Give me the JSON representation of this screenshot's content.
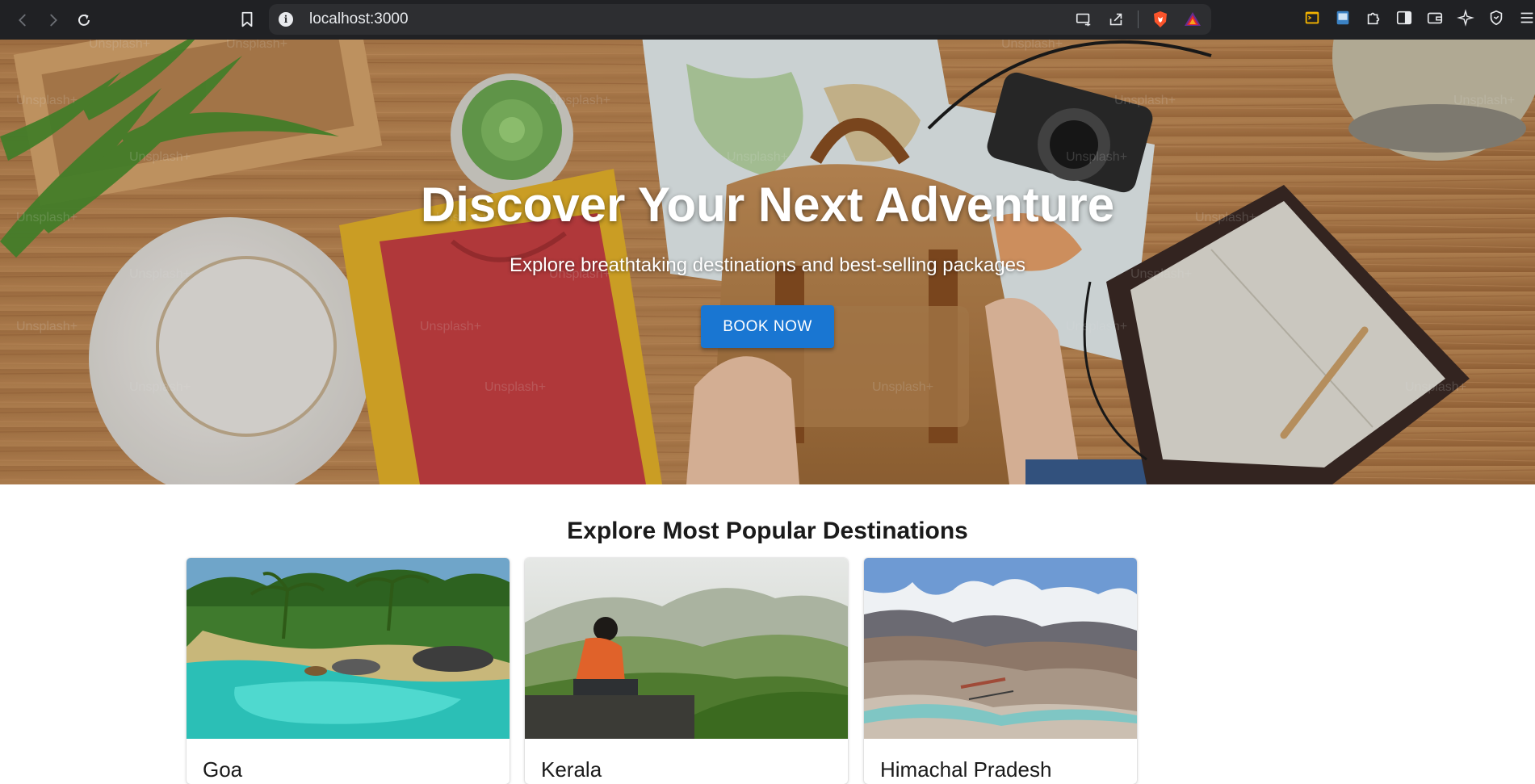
{
  "browser": {
    "url": "localhost:3000",
    "nav_icons": [
      "back-arrow-icon",
      "forward-arrow-icon",
      "reload-icon"
    ],
    "omnibox_icons": [
      "cast-icon",
      "share-icon",
      "brave-shields-icon",
      "brave-rewards-icon"
    ],
    "extension_icons": [
      "console-extension-icon",
      "notes-extension-icon",
      "puzzle-icon",
      "sidebar-icon",
      "wallet-icon",
      "leo-ai-icon",
      "vpn-shield-icon",
      "menu-icon"
    ]
  },
  "hero": {
    "title": "Discover Your Next Adventure",
    "subtitle": "Explore breathtaking destinations and best-selling packages",
    "cta_label": "BOOK NOW",
    "watermark": "Unsplash+"
  },
  "destinations": {
    "heading": "Explore Most Popular Destinations",
    "cards": [
      {
        "name": "Goa"
      },
      {
        "name": "Kerala"
      },
      {
        "name": "Himachal Pradesh"
      }
    ]
  },
  "colors": {
    "chrome_bg": "#202124",
    "omnibox_bg": "#2d2e31",
    "accent": "#1976d2"
  }
}
